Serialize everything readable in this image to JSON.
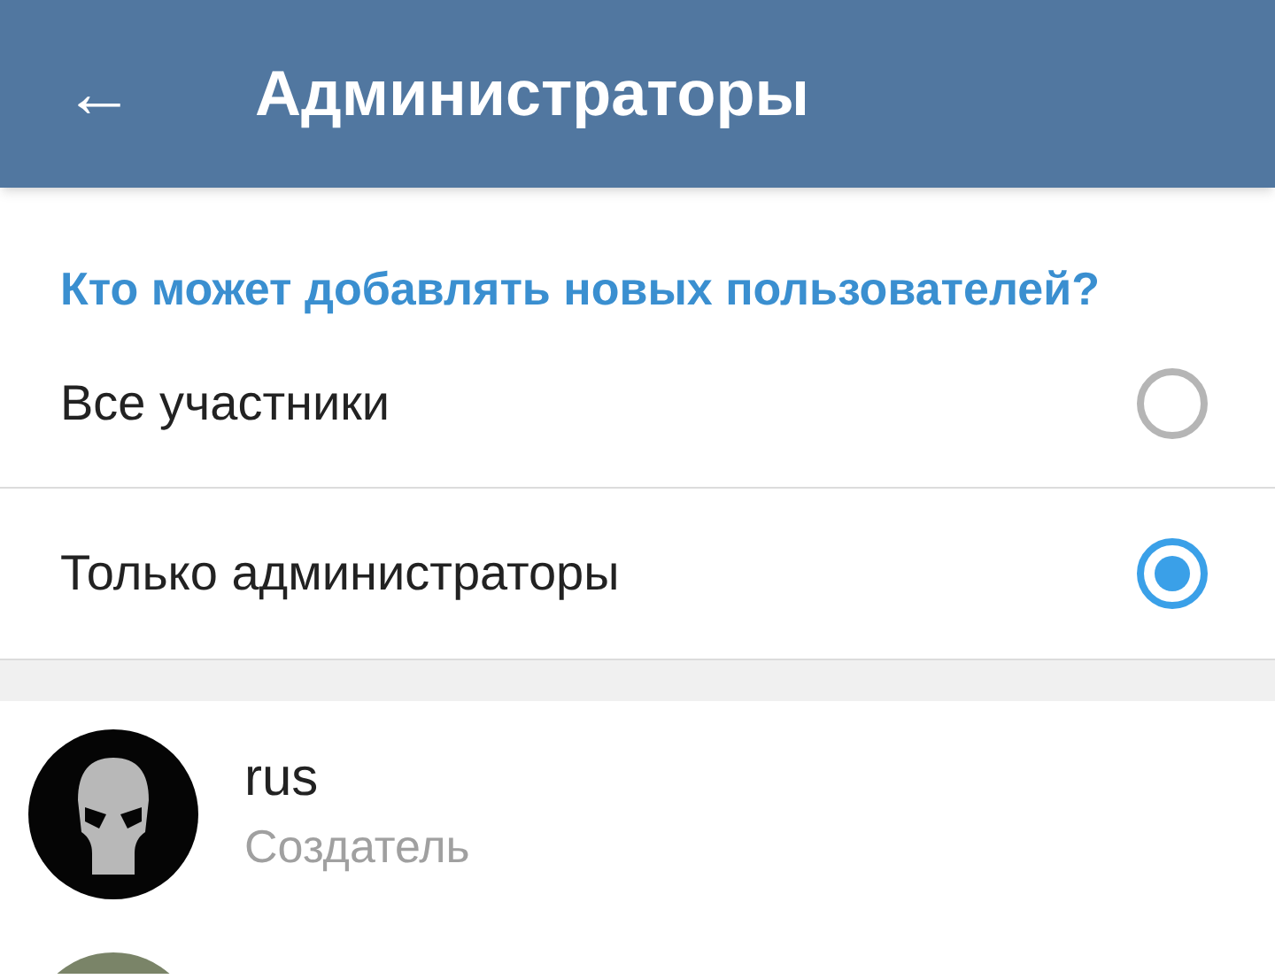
{
  "app_bar": {
    "back": "←",
    "title": "Администраторы"
  },
  "section": {
    "title": "Кто может добавлять новых пользователей?",
    "options": [
      {
        "label": "Все участники",
        "selected": false
      },
      {
        "label": "Только администраторы",
        "selected": true
      }
    ]
  },
  "admins": [
    {
      "name": "rus",
      "role": "Создатель"
    }
  ]
}
